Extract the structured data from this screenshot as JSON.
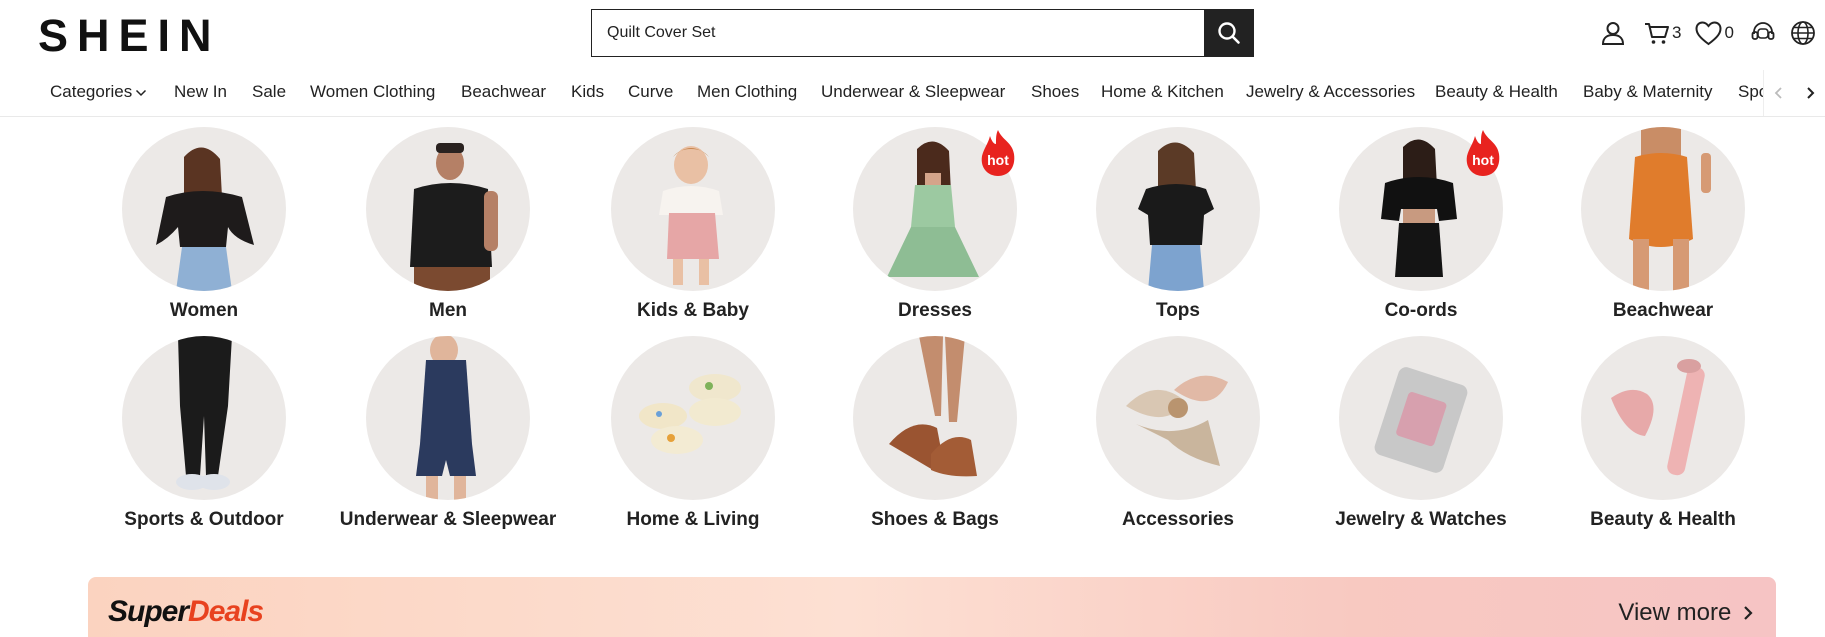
{
  "brand": "SHEIN",
  "search": {
    "value": "Quilt Cover Set"
  },
  "header_icons": {
    "cart_count": "3",
    "wishlist_count": "0"
  },
  "nav": {
    "items": [
      "Categories",
      "New In",
      "Sale",
      "Women Clothing",
      "Beachwear",
      "Kids",
      "Curve",
      "Men Clothing",
      "Underwear & Sleepwear",
      "Shoes",
      "Home & Kitchen",
      "Jewelry & Accessories",
      "Beauty & Health",
      "Baby & Maternity",
      "Spo"
    ]
  },
  "categories": [
    {
      "label": "Women",
      "hot": false
    },
    {
      "label": "Men",
      "hot": false
    },
    {
      "label": "Kids & Baby",
      "hot": false
    },
    {
      "label": "Dresses",
      "hot": true
    },
    {
      "label": "Tops",
      "hot": false
    },
    {
      "label": "Co-ords",
      "hot": true
    },
    {
      "label": "Beachwear",
      "hot": false
    },
    {
      "label": "Sports & Outdoor",
      "hot": false
    },
    {
      "label": "Underwear & Sleepwear",
      "hot": false
    },
    {
      "label": "Home & Living",
      "hot": false
    },
    {
      "label": "Shoes & Bags",
      "hot": false
    },
    {
      "label": "Accessories",
      "hot": false
    },
    {
      "label": "Jewelry & Watches",
      "hot": false
    },
    {
      "label": "Beauty & Health",
      "hot": false
    }
  ],
  "hot_badge": "hot",
  "super_deals": {
    "title_a": "Super",
    "title_b": "Deals",
    "view_more": "View more"
  },
  "colors": {
    "accent": "#222222",
    "hot": "#e8231f",
    "deals_bg": "#fbd3c0"
  },
  "icons": [
    "search-icon",
    "user-icon",
    "cart-icon",
    "heart-icon",
    "support-icon",
    "globe-icon",
    "chevron-left-icon",
    "chevron-right-icon",
    "chevron-down-icon",
    "fire-icon"
  ]
}
